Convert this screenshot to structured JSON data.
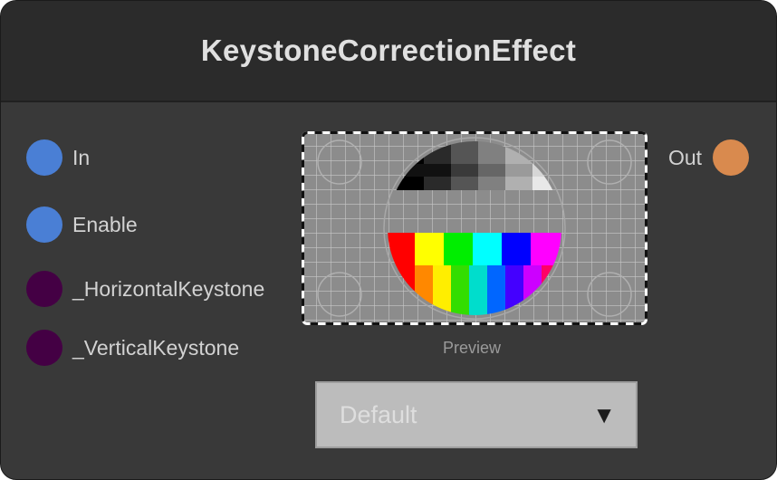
{
  "node": {
    "title": "KeystoneCorrectionEffect",
    "inputs": [
      {
        "label": "In",
        "color": "#4a7fd5"
      },
      {
        "label": "Enable",
        "color": "#4a7fd5"
      },
      {
        "label": "_HorizontalKeystone",
        "color": "#440044"
      },
      {
        "label": "_VerticalKeystone",
        "color": "#440044"
      }
    ],
    "output": {
      "label": "Out",
      "color": "#d98a4e"
    },
    "preview_label": "Preview",
    "dropdown": {
      "value": "Default",
      "arrow_icon": "▼"
    }
  }
}
